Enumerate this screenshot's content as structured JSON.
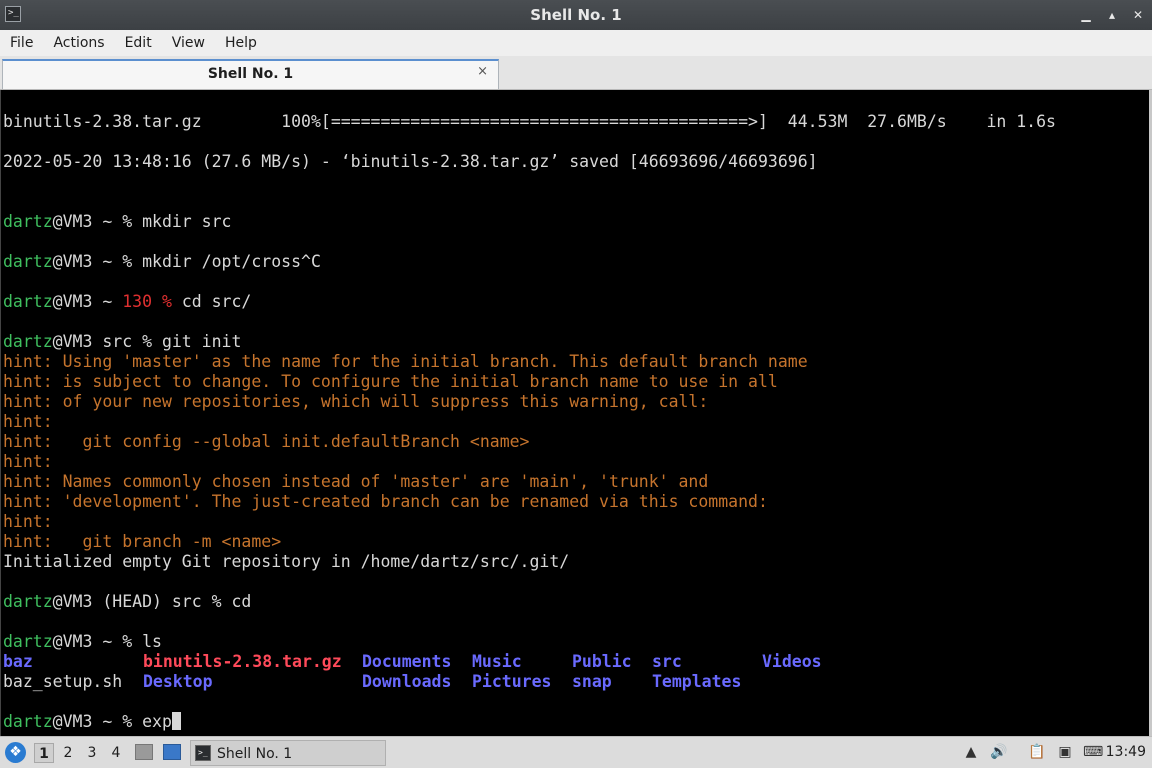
{
  "window": {
    "title": "Shell No. 1"
  },
  "menu": [
    "File",
    "Actions",
    "Edit",
    "View",
    "Help"
  ],
  "tab": {
    "label": "Shell No. 1",
    "close": "×"
  },
  "terminal": {
    "lines": {
      "wget": "binutils-2.38.tar.gz        100%[==========================================>]  44.53M  27.6MB/s    in 1.6s",
      "saved": "2022-05-20 13:48:16 (27.6 MB/s) - ‘binutils-2.38.tar.gz’ saved [46693696/46693696]",
      "p1_user": "dartz",
      "p1_rest": "@VM3 ~ % mkdir src",
      "p2_user": "dartz",
      "p2_rest": "@VM3 ~ % mkdir /opt/cross^C",
      "p3_user": "dartz",
      "p3_mid": "@VM3 ~ ",
      "p3_code": "130 %",
      "p3_rest": " cd src/",
      "p4_user": "dartz",
      "p4_rest": "@VM3 src % git init",
      "hints": [
        "hint: Using 'master' as the name for the initial branch. This default branch name",
        "hint: is subject to change. To configure the initial branch name to use in all",
        "hint: of your new repositories, which will suppress this warning, call:",
        "hint:",
        "hint:   git config --global init.defaultBranch <name>",
        "hint:",
        "hint: Names commonly chosen instead of 'master' are 'main', 'trunk' and",
        "hint: 'development'. The just-created branch can be renamed via this command:",
        "hint:",
        "hint:   git branch -m <name>"
      ],
      "init": "Initialized empty Git repository in /home/dartz/src/.git/",
      "p5_user": "dartz",
      "p5_rest": "@VM3 (HEAD) src % cd",
      "p6_user": "dartz",
      "p6_rest": "@VM3 ~ % ls",
      "ls": {
        "baz": "baz",
        "baz_setup": "baz_setup.sh",
        "binutils": "binutils-2.38.tar.gz",
        "desktop": "Desktop",
        "documents": "Documents",
        "downloads": "Downloads",
        "music": "Music",
        "pictures": "Pictures",
        "public": "Public",
        "snap": "snap",
        "src": "src",
        "templates": "Templates",
        "videos": "Videos"
      },
      "p7_user": "dartz",
      "p7_rest": "@VM3 ~ % exp"
    }
  },
  "taskbar": {
    "workspaces": [
      "1",
      "2",
      "3",
      "4"
    ],
    "task_label": "Shell No. 1",
    "clock": "13:49"
  },
  "colors": {
    "user": "#3fbf5f",
    "hint": "#c6742d",
    "dir": "#6a6aff",
    "archive": "#ff4a5a",
    "error": "#e03030"
  }
}
